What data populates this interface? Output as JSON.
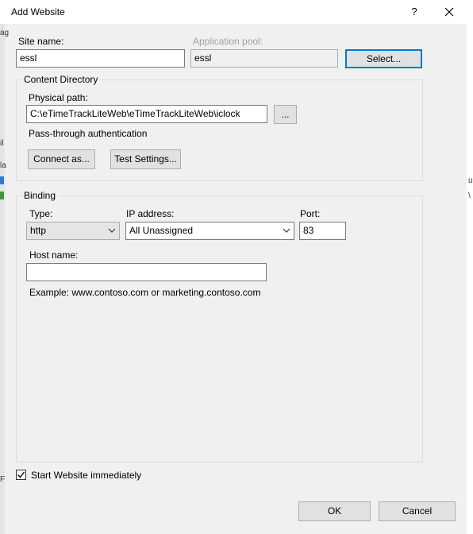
{
  "window": {
    "title": "Add Website",
    "help_label": "?",
    "close_label": "✕"
  },
  "background": {
    "snippets": [
      "ag",
      "il",
      "la",
      "u",
      "\\",
      "F"
    ]
  },
  "site": {
    "site_name_label": "Site name:",
    "site_name_value": "essl",
    "app_pool_label": "Application pool:",
    "app_pool_value": "essl",
    "select_button": "Select..."
  },
  "content_directory": {
    "title": "Content Directory",
    "physical_path_label": "Physical path:",
    "physical_path_value": "C:\\eTimeTrackLiteWeb\\eTimeTrackLiteWeb\\iclock",
    "browse_button": "...",
    "pass_through_label": "Pass-through authentication",
    "connect_as_button": "Connect as...",
    "test_settings_button": "Test Settings..."
  },
  "binding": {
    "title": "Binding",
    "type_label": "Type:",
    "type_value": "http",
    "ip_label": "IP address:",
    "ip_value": "All Unassigned",
    "port_label": "Port:",
    "port_value": "83",
    "host_label": "Host name:",
    "host_value": "",
    "example_text": "Example: www.contoso.com or marketing.contoso.com"
  },
  "start_website": {
    "label": "Start Website immediately",
    "checked": true
  },
  "footer": {
    "ok_button": "OK",
    "cancel_button": "Cancel"
  }
}
